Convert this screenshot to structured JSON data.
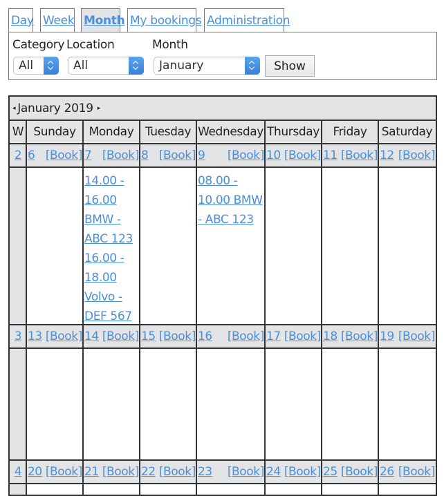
{
  "tabs": [
    {
      "label": "Day",
      "active": false
    },
    {
      "label": "Week",
      "active": false
    },
    {
      "label": "Month",
      "active": true
    },
    {
      "label": "My bookings",
      "active": false
    },
    {
      "label": "Administration",
      "active": false
    }
  ],
  "filters": {
    "category": {
      "label": "Category",
      "value": "All"
    },
    "location": {
      "label": "Location",
      "value": "All"
    },
    "month": {
      "label": "Month",
      "value": "January"
    },
    "show_label": "Show"
  },
  "calendar": {
    "title": "January 2019",
    "prev_icon": "◂",
    "next_icon": "▸",
    "week_header": "W",
    "day_headers": [
      "Sunday",
      "Monday",
      "Tuesday",
      "Wednesday",
      "Thursday",
      "Friday",
      "Saturday"
    ],
    "book_label": "[Book]",
    "weeks": [
      {
        "week": "2",
        "days": [
          "6",
          "7",
          "8",
          "9",
          "10",
          "11",
          "12"
        ]
      },
      {
        "week": "3",
        "days": [
          "13",
          "14",
          "15",
          "16",
          "17",
          "18",
          "19"
        ]
      },
      {
        "week": "4",
        "days": [
          "20",
          "21",
          "22",
          "23",
          "24",
          "25",
          "26"
        ]
      }
    ],
    "events": {
      "monday_week2": [
        [
          "14.00 -",
          "16.00",
          "BMW -",
          "ABC 123"
        ],
        [
          "16.00 -",
          "18.00",
          "Volvo -",
          "DEF 567"
        ]
      ],
      "wednesday_week2": [
        [
          "08.00 -",
          "10.00 BMW",
          "- ABC 123"
        ]
      ]
    }
  },
  "colors": {
    "link": "#4a8fd9",
    "header_bg": "#e3e4e6",
    "grid": "#333333",
    "select_accent": "#3a7fd8"
  }
}
